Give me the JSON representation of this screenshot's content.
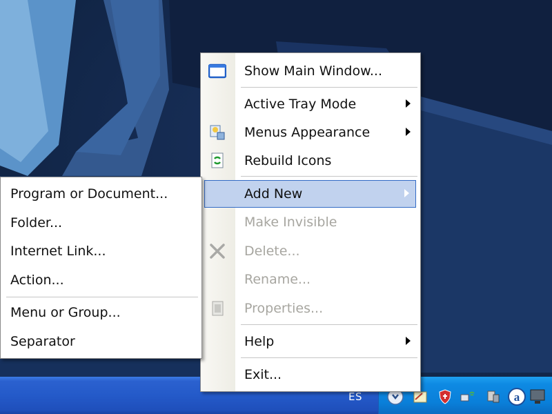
{
  "main_menu": {
    "items": [
      {
        "label": "Show Main Window...",
        "icon": "window-icon",
        "enabled": true
      },
      {
        "label": "Active Tray Mode",
        "icon": null,
        "enabled": true,
        "submenu": true
      },
      {
        "label": "Menus Appearance",
        "icon": "appearance-icon",
        "enabled": true,
        "submenu": true
      },
      {
        "label": "Rebuild Icons",
        "icon": "rebuild-icon",
        "enabled": true
      },
      {
        "label": "Add New",
        "icon": null,
        "enabled": true,
        "submenu": true,
        "highlighted": true
      },
      {
        "label": "Make Invisible",
        "icon": null,
        "enabled": false
      },
      {
        "label": "Delete...",
        "icon": "delete-icon",
        "enabled": false
      },
      {
        "label": "Rename...",
        "icon": null,
        "enabled": false
      },
      {
        "label": "Properties...",
        "icon": "properties-icon",
        "enabled": false
      },
      {
        "label": "Help",
        "icon": null,
        "enabled": true,
        "submenu": true
      },
      {
        "label": "Exit...",
        "icon": null,
        "enabled": true
      }
    ]
  },
  "add_new_submenu": {
    "items": [
      {
        "label": "Program or Document..."
      },
      {
        "label": "Folder..."
      },
      {
        "label": "Internet Link..."
      },
      {
        "label": "Action..."
      },
      {
        "label": "Menu or Group..."
      },
      {
        "label": "Separator"
      }
    ]
  },
  "taskbar": {
    "language": "ES",
    "tray_icons": [
      "true-launch-bar-icon",
      "notes-icon",
      "shield-icon",
      "network-icon",
      "device-icon",
      "avast-icon",
      "display-icon"
    ]
  },
  "colors": {
    "highlight": "#c1d2ee",
    "highlight_border": "#316ac5",
    "disabled_text": "#a7a6a0",
    "taskbar": "#245ac9",
    "tray": "#0a7fd9"
  }
}
